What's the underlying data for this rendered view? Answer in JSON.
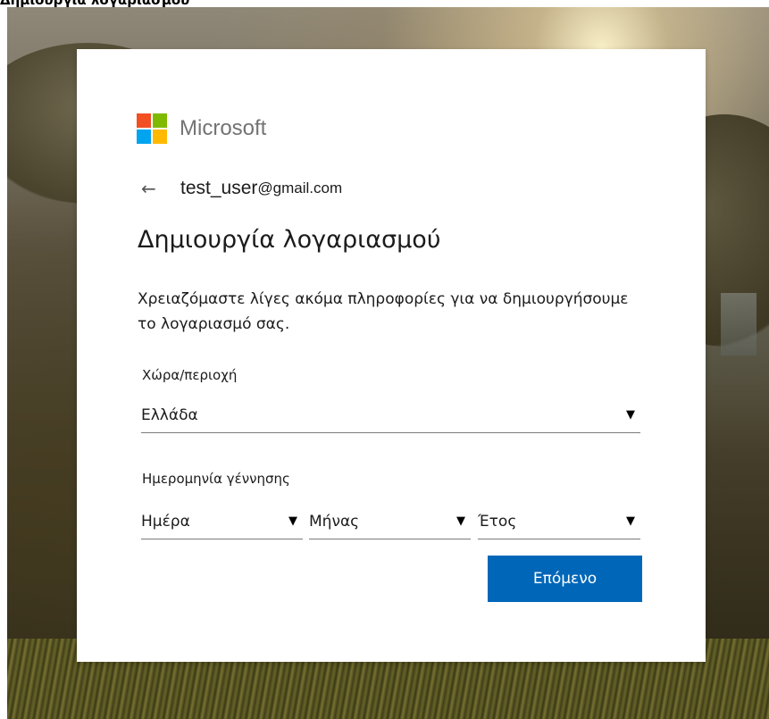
{
  "page": {
    "title_strip": "Δημιουργία λογαριασμού"
  },
  "brand": {
    "name": "Microsoft",
    "logo_colors": [
      "#f25022",
      "#7fba00",
      "#00a4ef",
      "#ffb900"
    ]
  },
  "identity": {
    "back_icon": "←",
    "username": "test_user",
    "domain": "@gmail.com"
  },
  "heading": "Δημιουργία λογαριασμού",
  "description": "Χρειαζόμαστε λίγες ακόμα πληροφορίες για να δημιουργήσουμε το λογαριασμό σας.",
  "country": {
    "label": "Χώρα/περιοχή",
    "value": "Ελλάδα"
  },
  "birthdate": {
    "label": "Ημερομηνία γέννησης",
    "day": "Ημέρα",
    "month": "Μήνας",
    "year": "Έτος"
  },
  "caret_icon": "▼",
  "next_button": "Επόμενο",
  "accent_color": "#0067b8"
}
